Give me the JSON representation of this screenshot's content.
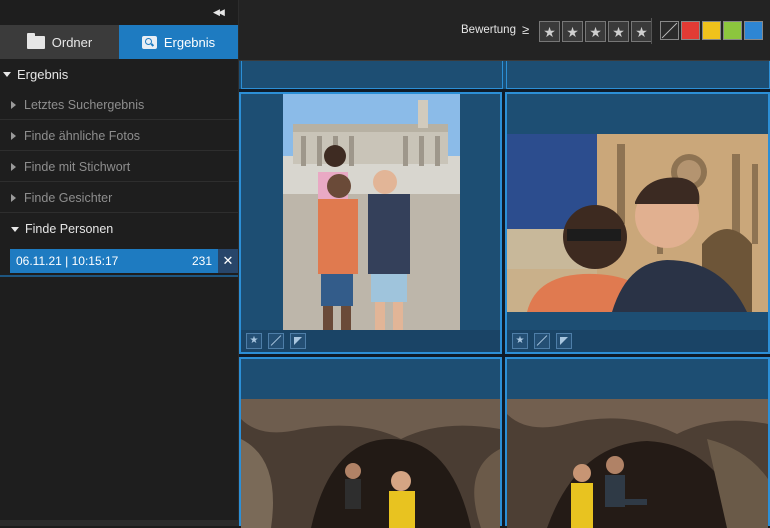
{
  "sidebar": {
    "collapse_glyph": "◀◀",
    "tabs": [
      {
        "label": "Ordner",
        "icon": "folder-icon",
        "active": false
      },
      {
        "label": "Ergebnis",
        "icon": "search-icon",
        "active": true
      }
    ],
    "tree_title": "Ergebnis",
    "items": [
      {
        "label": "Letztes Suchergebnis"
      },
      {
        "label": "Finde ähnliche Fotos"
      },
      {
        "label": "Finde mit Stichwort"
      },
      {
        "label": "Finde Gesichter"
      },
      {
        "label": "Finde Personen",
        "expanded": true
      }
    ],
    "result": {
      "date": "06.11.21 | 10:15:17",
      "count": "231",
      "close_glyph": "✕"
    }
  },
  "toolbar": {
    "rating_label": "Bewertung",
    "rating_operator": "≥",
    "star_glyph": "★",
    "stars_count": 5,
    "colors": [
      "#e23b34",
      "#f0c21c",
      "#8cc63e",
      "#2e86d4"
    ],
    "accent": "#1e7bc1"
  },
  "grid": {
    "thumb_icons": [
      "star-icon",
      "reject-icon",
      "flag-icon"
    ],
    "star_glyph": "★"
  }
}
